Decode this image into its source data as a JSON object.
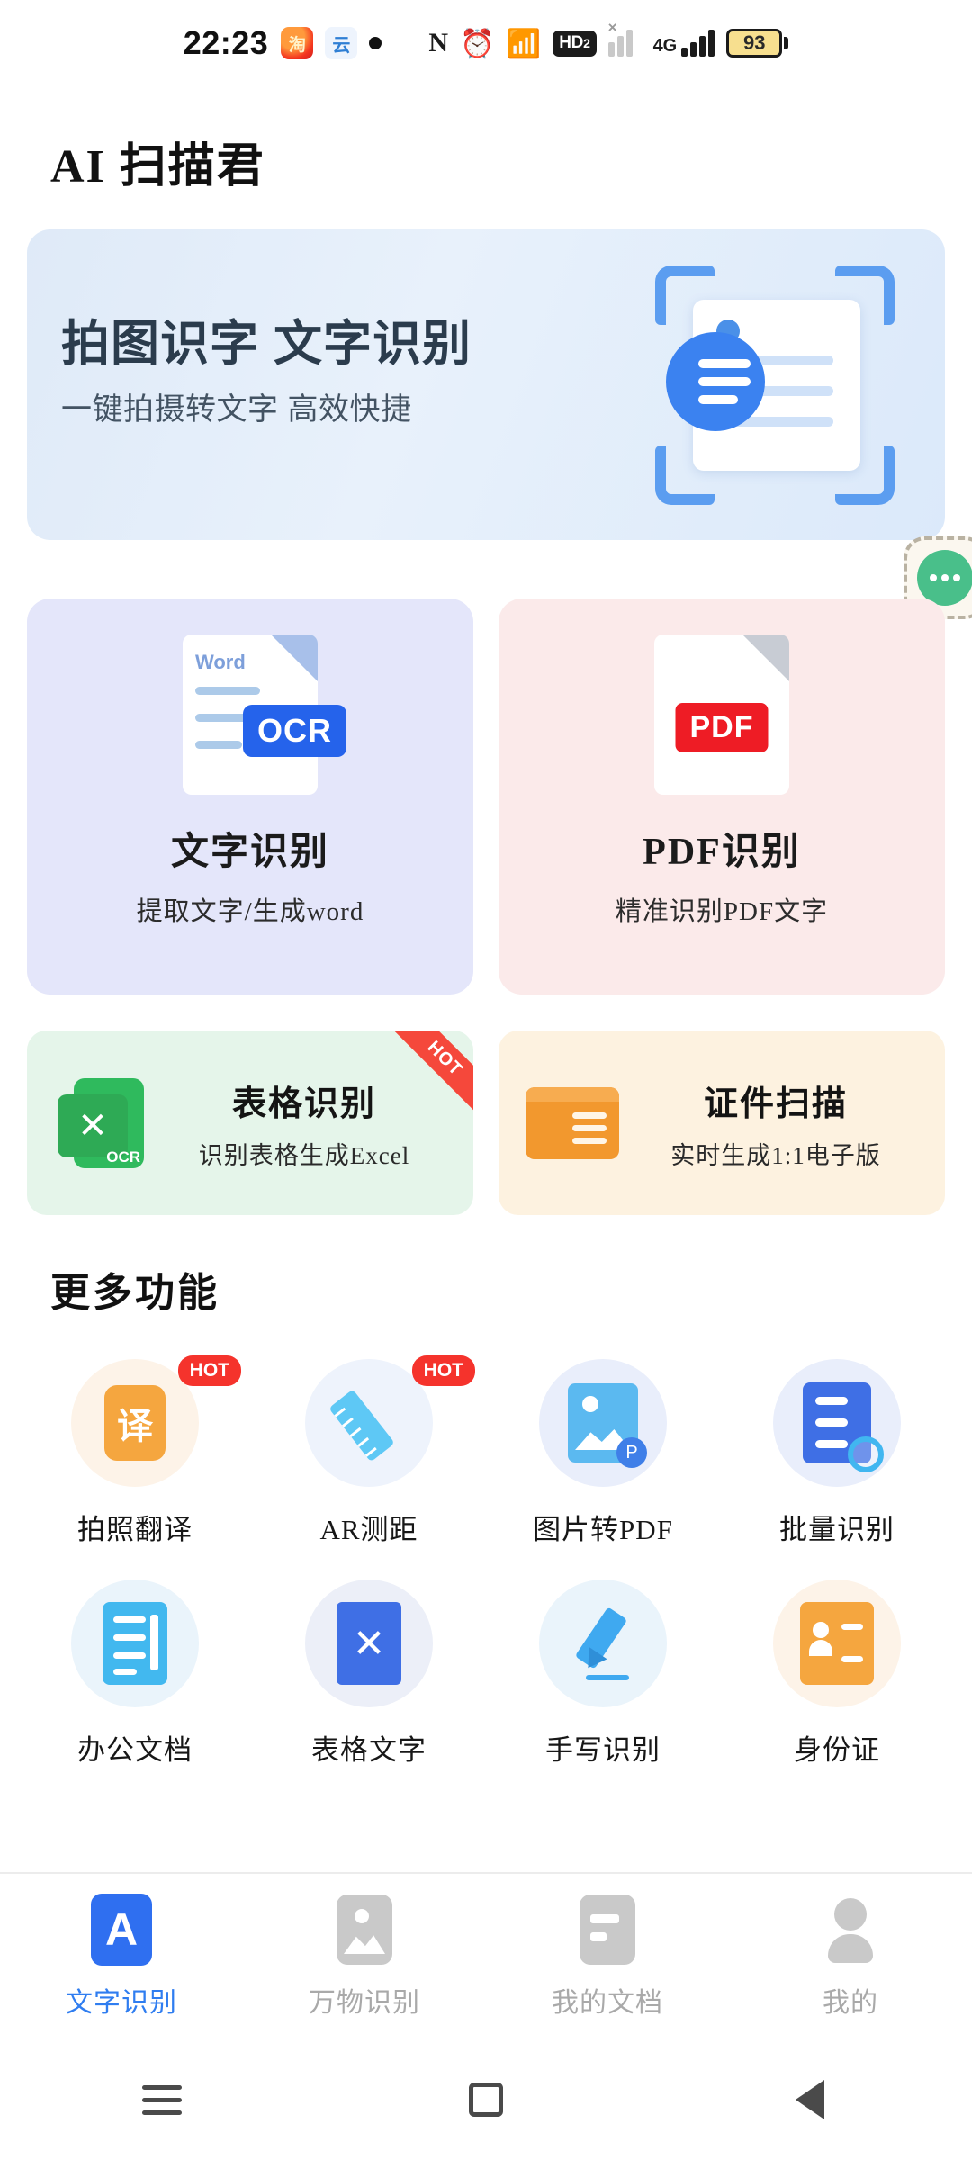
{
  "status_bar": {
    "time": "22:23",
    "taobao_icon_char": "淘",
    "cloud_icon_char": "云",
    "nfc_label": "N",
    "hd_label": "HD",
    "hd_sub": "2",
    "network_label": "4G",
    "signal_cross": "×",
    "battery_percent": "93"
  },
  "header": {
    "app_title": "AI 扫描君"
  },
  "hero": {
    "title": "拍图识字  文字识别",
    "subtitle": "一键拍摄转文字  高效快捷"
  },
  "float_widget": {
    "name": "floating-assistant"
  },
  "big_cards": [
    {
      "title": "文字识别",
      "subtitle": "提取文字/生成word",
      "icon_label": "Word",
      "chip": "OCR",
      "bg": "#e4e6fa",
      "chip_color": "#2563eb"
    },
    {
      "title": "PDF识别",
      "subtitle": "精准识别PDF文字",
      "chip": "PDF",
      "bg": "#fbeaea",
      "chip_color": "#ee1c25"
    }
  ],
  "small_cards": [
    {
      "title": "表格识别",
      "subtitle": "识别表格生成Excel",
      "badge": "HOT",
      "icon_char": "✕",
      "icon_sub": "OCR",
      "bg": "#e5f5ea"
    },
    {
      "title": "证件扫描",
      "subtitle": "实时生成1:1电子版",
      "bg": "#fdf2e0"
    }
  ],
  "more": {
    "section_title": "更多功能",
    "items": [
      {
        "label": "拍照翻译",
        "badge": "HOT",
        "icon": "translate-icon",
        "glyph": "译"
      },
      {
        "label": "AR测距",
        "badge": "HOT",
        "icon": "ruler-icon"
      },
      {
        "label": "图片转PDF",
        "badge": "",
        "icon": "image-to-pdf-icon",
        "glyph": "P"
      },
      {
        "label": "批量识别",
        "badge": "",
        "icon": "batch-recognize-icon"
      },
      {
        "label": "办公文档",
        "badge": "",
        "icon": "office-doc-icon"
      },
      {
        "label": "表格文字",
        "badge": "",
        "icon": "table-text-icon",
        "glyph": "✕"
      },
      {
        "label": "手写识别",
        "badge": "",
        "icon": "handwriting-icon"
      },
      {
        "label": "身份证",
        "badge": "",
        "icon": "id-card-icon"
      }
    ]
  },
  "tabs": [
    {
      "label": "文字识别",
      "icon": "text-recognize-icon",
      "glyph": "A",
      "active": true
    },
    {
      "label": "万物识别",
      "icon": "image-recognize-icon",
      "active": false
    },
    {
      "label": "我的文档",
      "icon": "my-documents-icon",
      "active": false
    },
    {
      "label": "我的",
      "icon": "profile-icon",
      "active": false
    }
  ],
  "nav_bar": {
    "recents": "recent-apps-button",
    "home": "home-button",
    "back": "back-button"
  },
  "colors": {
    "accent": "#2f6ff0",
    "hot": "#f5332c",
    "pdf_red": "#ee1c25",
    "excel_green": "#2eaa55",
    "id_orange": "#f2982e"
  }
}
